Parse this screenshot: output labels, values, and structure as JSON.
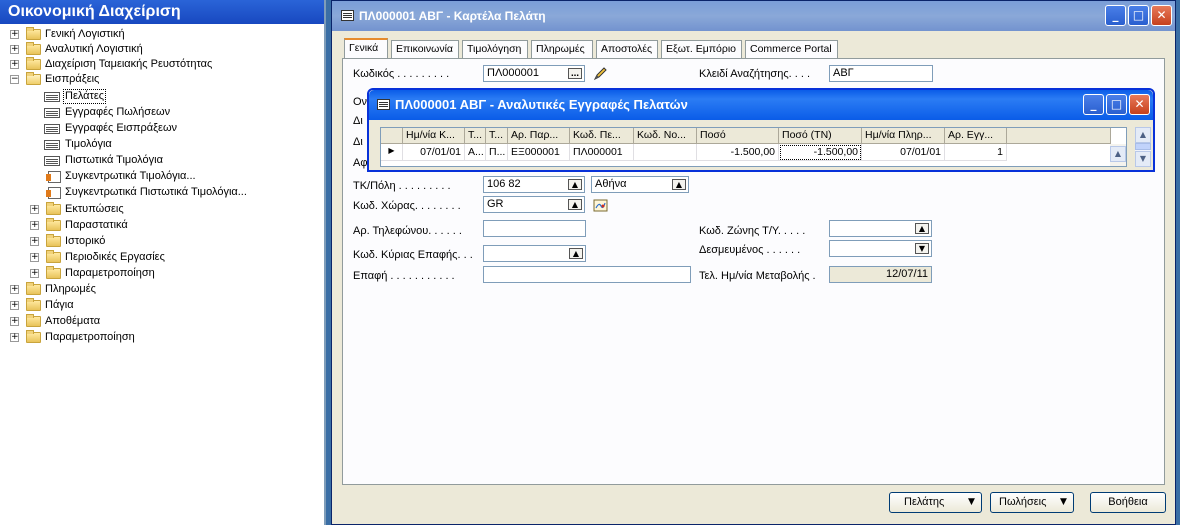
{
  "nav": {
    "title": "Οικονομική Διαχείριση",
    "items": [
      {
        "label": "Γενική Λογιστική",
        "icon": "folder",
        "expander": "+"
      },
      {
        "label": "Αναλυτική Λογιστική",
        "icon": "folder",
        "expander": "+"
      },
      {
        "label": "Διαχείριση Ταμειακής Ρευστότητας",
        "icon": "folder",
        "expander": "+"
      },
      {
        "label": "Εισπράξεις",
        "icon": "folder-open",
        "expander": "−"
      },
      {
        "label": "Πελάτες",
        "icon": "form"
      },
      {
        "label": "Εγγραφές Πωλήσεων",
        "icon": "form"
      },
      {
        "label": "Εγγραφές Εισπράξεων",
        "icon": "form"
      },
      {
        "label": "Τιμολόγια",
        "icon": "form"
      },
      {
        "label": "Πιστωτικά Τιμολόγια",
        "icon": "form"
      },
      {
        "label": "Συγκεντρωτικά Τιμολόγια...",
        "icon": "report"
      },
      {
        "label": "Συγκεντρωτικά Πιστωτικά Τιμολόγια...",
        "icon": "report"
      },
      {
        "label": "Εκτυπώσεις",
        "icon": "folder",
        "expander": "+"
      },
      {
        "label": "Παραστατικά",
        "icon": "folder",
        "expander": "+"
      },
      {
        "label": "Ιστορικό",
        "icon": "folder",
        "expander": "+"
      },
      {
        "label": "Περιοδικές Εργασίες",
        "icon": "folder",
        "expander": "+"
      },
      {
        "label": "Παραμετροποίηση",
        "icon": "folder",
        "expander": "+"
      },
      {
        "label": "Πληρωμές",
        "icon": "folder",
        "expander": "+"
      },
      {
        "label": "Πάγια",
        "icon": "folder",
        "expander": "+"
      },
      {
        "label": "Αποθέματα",
        "icon": "folder",
        "expander": "+"
      },
      {
        "label": "Παραμετροποίηση",
        "icon": "folder",
        "expander": "+"
      }
    ]
  },
  "card": {
    "title": "ΠΛ000001 ΑΒΓ - Καρτέλα Πελάτη",
    "window_buttons": {
      "minimize": "_",
      "maximize": "□",
      "close": "✕"
    },
    "tabs": [
      "Γενικά",
      "Επικοινωνία",
      "Τιμολόγηση",
      "Πληρωμές",
      "Αποστολές",
      "Εξωτ. Εμπόριο",
      "Commerce Portal"
    ],
    "fields": {
      "code_label": "Κωδικός . . . . . . . . .",
      "code_value": "ΠΛ000001",
      "search_key_label": "Κλειδί Αναζήτησης. . . .",
      "search_key_value": "ΑΒΓ",
      "hidden_label_1": "Ον",
      "hidden_label_2": "Δι",
      "hidden_label_3": "Δι",
      "hidden_label_4": "Αφ",
      "zip_city_label": "ΤΚ/Πόλη . . . . . . . . .",
      "zip_value": "106 82",
      "city_value": "Αθήνα",
      "country_label": "Κωδ. Χώρας. . . . . . . .",
      "country_value": "GR",
      "phone_label": "Αρ. Τηλεφώνου. . . . . .",
      "phone_value": "",
      "primary_contact_label": "Κωδ. Κύριας Επαφής. . .",
      "primary_contact_value": "",
      "contact_label": "Επαφή . . . . . . . . . . .",
      "contact_value": "",
      "zone_label": "Κωδ. Ζώνης Τ/Υ. . . . .",
      "zone_value": "",
      "blocked_label": "Δεσμευμένος . . . . . .",
      "blocked_value": "",
      "last_modified_label": "Τελ. Ημ/νία Μεταβολής .",
      "last_modified_value": "12/07/11"
    },
    "buttons": {
      "customer": "Πελάτης",
      "sales": "Πωλήσεις",
      "help": "Βοήθεια"
    }
  },
  "ledger": {
    "title": "ΠΛ000001 ΑΒΓ - Αναλυτικές Εγγραφές Πελατών",
    "window_buttons": {
      "minimize": "_",
      "maximize": "□",
      "close": "✕"
    },
    "columns": [
      "Ημ/νία Κ...",
      "Τ...",
      "Τ...",
      "Αρ. Παρ...",
      "Κωδ. Πε...",
      "Κωδ. Νο...",
      "Ποσό",
      "Ποσό (ΤΝ)",
      "Ημ/νία Πληρ...",
      "Αρ. Εγγ..."
    ],
    "rows": [
      {
        "marker": "▶",
        "cells": [
          "07/01/01",
          "Α...",
          "Π...",
          "ΕΞ000001",
          "ΠΛ000001",
          "",
          "-1.500,00",
          "-1.500,00",
          "07/01/01",
          "1"
        ]
      }
    ]
  },
  "colors": {
    "nav_title_bg": "#1848c0",
    "card_title_bg": "#7a9ed8",
    "ledger_title_bg": "#0a5ce8",
    "active_tab_accent": "#e68b2c",
    "desktop_bg": "#3a6ea5"
  }
}
